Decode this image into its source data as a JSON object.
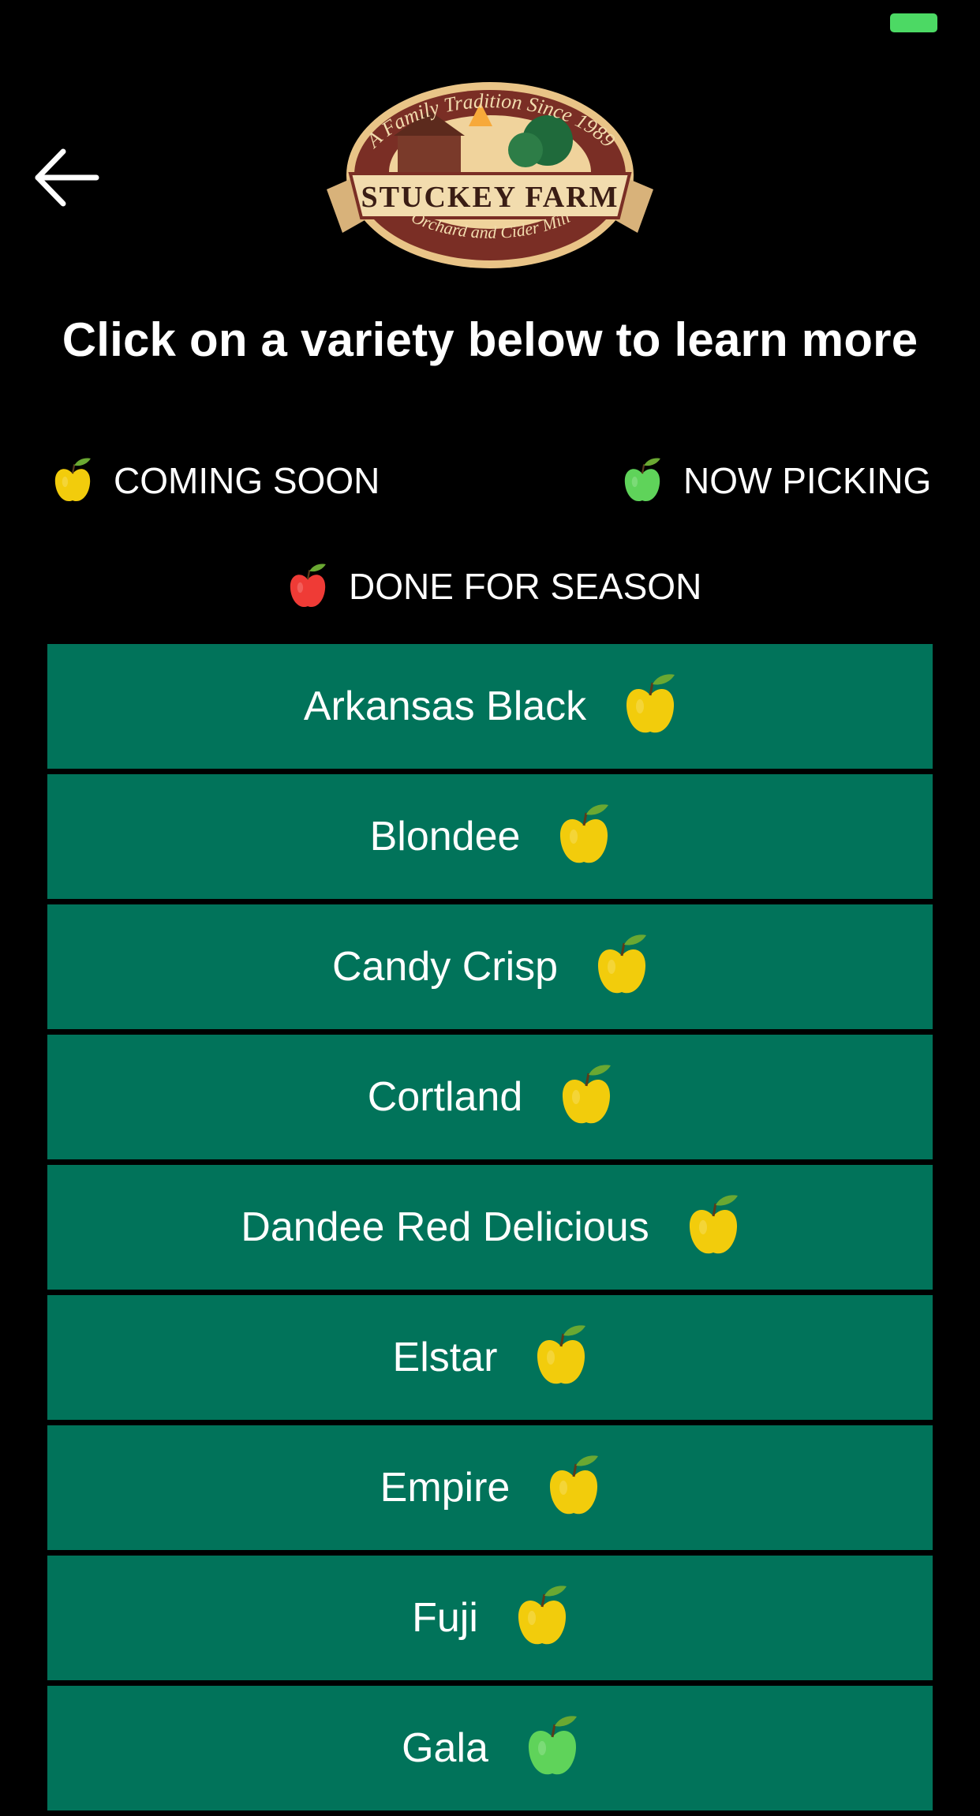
{
  "status_bar": {
    "battery_color": "#4cd964"
  },
  "header": {
    "back_icon": "back-arrow-icon",
    "logo": {
      "top_arc": "A Family Tradition Since 1989",
      "name": "STUCKEY FARM",
      "bottom_arc": "Orchard and Cider Mill"
    }
  },
  "headline": "Click on a variety below to learn more",
  "legend": {
    "coming_soon": "COMING SOON",
    "now_picking": "NOW PICKING",
    "done_for_season": "DONE FOR SEASON"
  },
  "colors": {
    "row_bg": "#01735a",
    "coming_soon": "#f2cc0c",
    "now_picking": "#5fd35a",
    "done_for_season": "#ef3b36",
    "leaf": "#6aa832"
  },
  "varieties": [
    {
      "name": "Arkansas Black",
      "status": "coming_soon"
    },
    {
      "name": "Blondee",
      "status": "coming_soon"
    },
    {
      "name": "Candy Crisp",
      "status": "coming_soon"
    },
    {
      "name": "Cortland",
      "status": "coming_soon"
    },
    {
      "name": "Dandee Red Delicious",
      "status": "coming_soon"
    },
    {
      "name": "Elstar",
      "status": "coming_soon"
    },
    {
      "name": "Empire",
      "status": "coming_soon"
    },
    {
      "name": "Fuji",
      "status": "coming_soon"
    },
    {
      "name": "Gala",
      "status": "now_picking"
    }
  ]
}
